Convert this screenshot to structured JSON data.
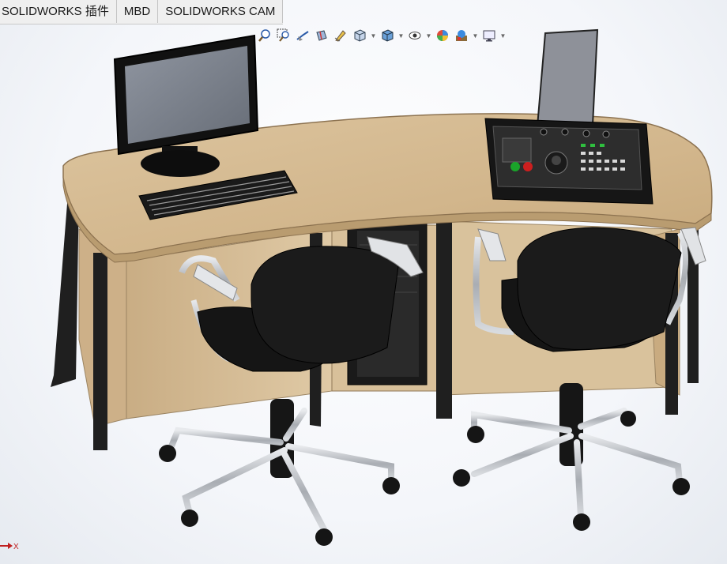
{
  "tabs": [
    {
      "label": "SOLIDWORKS 插件"
    },
    {
      "label": "MBD"
    },
    {
      "label": "SOLIDWORKS CAM"
    }
  ],
  "view_toolbar": {
    "icons": [
      "zoom-to-fit-icon",
      "zoom-to-area-icon",
      "previous-view-icon",
      "section-view-icon",
      "dynamic-annotation-icon",
      "view-orientation-icon",
      "display-style-icon",
      "hide-show-items-icon",
      "edit-appearance-icon",
      "apply-scene-icon",
      "view-settings-icon"
    ]
  },
  "triad": {
    "axis_label": "X"
  },
  "model": {
    "name": "control desk assembly",
    "colors": {
      "desk_top": "#d3b890",
      "desk_edge": "#c2a57a",
      "frame": "#1e1e1e",
      "chair": "#141414",
      "chrome": "#b8bcc2"
    }
  }
}
